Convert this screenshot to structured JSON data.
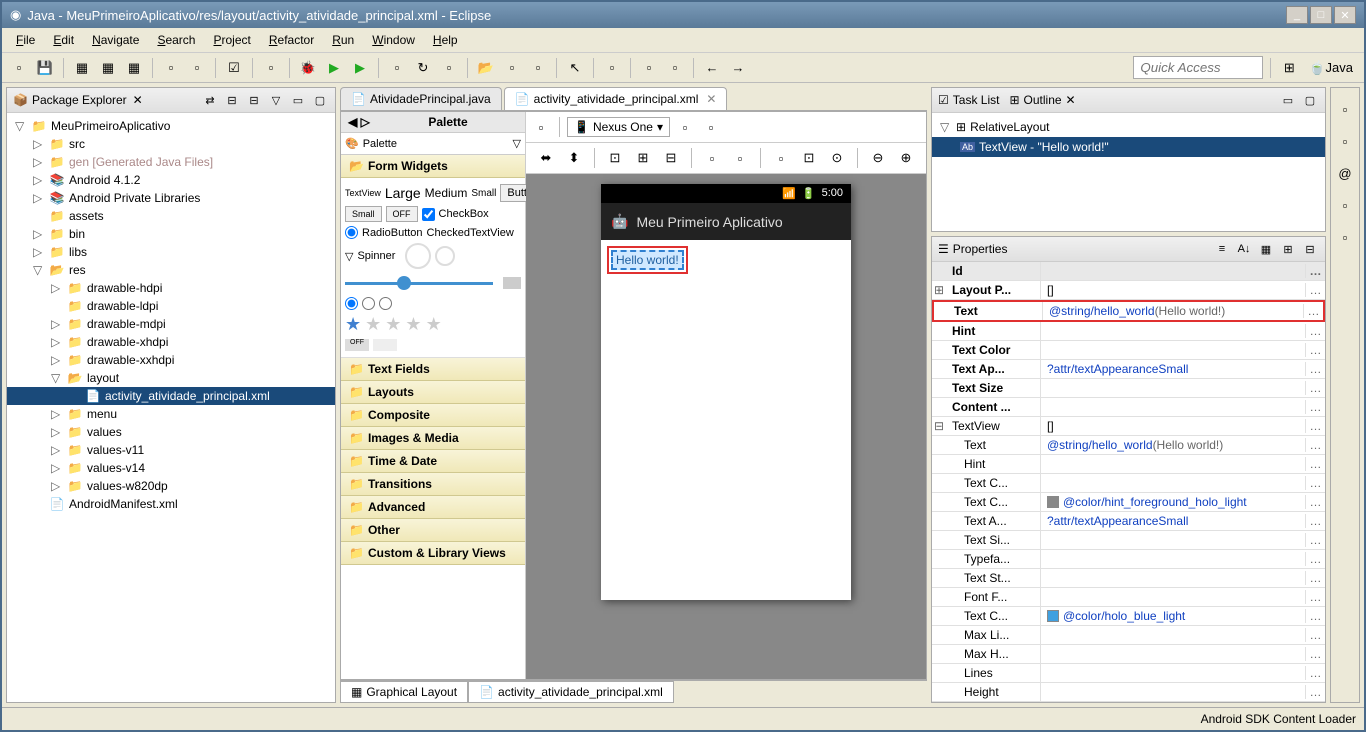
{
  "window": {
    "title": "Java - MeuPrimeiroAplicativo/res/layout/activity_atividade_principal.xml - Eclipse"
  },
  "menu": [
    "File",
    "Edit",
    "Navigate",
    "Search",
    "Project",
    "Refactor",
    "Run",
    "Window",
    "Help"
  ],
  "quick_access_placeholder": "Quick Access",
  "perspective_label": "Java",
  "package_explorer": {
    "title": "Package Explorer",
    "project": "MeuPrimeiroAplicativo",
    "items": [
      {
        "depth": 1,
        "tw": "▷",
        "icon": "📁",
        "label": "src"
      },
      {
        "depth": 1,
        "tw": "▷",
        "icon": "📁",
        "label": "gen [Generated Java Files]",
        "gen": true
      },
      {
        "depth": 1,
        "tw": "▷",
        "icon": "📚",
        "label": "Android 4.1.2"
      },
      {
        "depth": 1,
        "tw": "▷",
        "icon": "📚",
        "label": "Android Private Libraries"
      },
      {
        "depth": 1,
        "tw": "",
        "icon": "📁",
        "label": "assets"
      },
      {
        "depth": 1,
        "tw": "▷",
        "icon": "📁",
        "label": "bin"
      },
      {
        "depth": 1,
        "tw": "▷",
        "icon": "📁",
        "label": "libs"
      },
      {
        "depth": 1,
        "tw": "▽",
        "icon": "📂",
        "label": "res"
      },
      {
        "depth": 2,
        "tw": "▷",
        "icon": "📁",
        "label": "drawable-hdpi"
      },
      {
        "depth": 2,
        "tw": "",
        "icon": "📁",
        "label": "drawable-ldpi"
      },
      {
        "depth": 2,
        "tw": "▷",
        "icon": "📁",
        "label": "drawable-mdpi"
      },
      {
        "depth": 2,
        "tw": "▷",
        "icon": "📁",
        "label": "drawable-xhdpi"
      },
      {
        "depth": 2,
        "tw": "▷",
        "icon": "📁",
        "label": "drawable-xxhdpi"
      },
      {
        "depth": 2,
        "tw": "▽",
        "icon": "📂",
        "label": "layout"
      },
      {
        "depth": 3,
        "tw": "",
        "icon": "📄",
        "label": "activity_atividade_principal.xml",
        "sel": true
      },
      {
        "depth": 2,
        "tw": "▷",
        "icon": "📁",
        "label": "menu"
      },
      {
        "depth": 2,
        "tw": "▷",
        "icon": "📁",
        "label": "values"
      },
      {
        "depth": 2,
        "tw": "▷",
        "icon": "📁",
        "label": "values-v11"
      },
      {
        "depth": 2,
        "tw": "▷",
        "icon": "📁",
        "label": "values-v14"
      },
      {
        "depth": 2,
        "tw": "▷",
        "icon": "📁",
        "label": "values-w820dp"
      },
      {
        "depth": 1,
        "tw": "",
        "icon": "📄",
        "label": "AndroidManifest.xml"
      }
    ]
  },
  "editor": {
    "tabs": [
      {
        "label": "AtividadePrincipal.java",
        "active": false
      },
      {
        "label": "activity_atividade_principal.xml",
        "active": true
      }
    ],
    "palette_title": "Palette",
    "palette_label": "Palette",
    "sections": {
      "form_widgets": "Form Widgets",
      "text_fields": "Text Fields",
      "layouts": "Layouts",
      "composite": "Composite",
      "images_media": "Images & Media",
      "time_date": "Time & Date",
      "transitions": "Transitions",
      "advanced": "Advanced",
      "other": "Other",
      "custom": "Custom & Library Views"
    },
    "widgets": {
      "textview": "TextView",
      "large": "Large",
      "medium": "Medium",
      "small": "Small",
      "button": "Button",
      "small_btn": "Small",
      "off": "OFF",
      "checkbox": "CheckBox",
      "radiobutton": "RadioButton",
      "checkedtext": "CheckedTextView",
      "spinner": "Spinner"
    },
    "device": "Nexus One",
    "phone": {
      "time": "5:00",
      "app_title": "Meu Primeiro Aplicativo",
      "hello": "Hello world!"
    },
    "bottom_tabs": [
      "Graphical Layout",
      "activity_atividade_principal.xml"
    ]
  },
  "outline": {
    "tabs": [
      "Task List",
      "Outline"
    ],
    "root": "RelativeLayout",
    "child": "TextView - \"Hello world!\""
  },
  "properties": {
    "title": "Properties",
    "header_id": "Id",
    "rows": [
      {
        "expand": "⊞",
        "name": "Layout P...",
        "val": "[]",
        "bold": true
      },
      {
        "expand": "",
        "name": "Text",
        "val_link": "@string/hello_world",
        "val_hint": " (Hello world!)",
        "bold": true,
        "hl": true
      },
      {
        "expand": "",
        "name": "Hint",
        "val": "",
        "bold": true
      },
      {
        "expand": "",
        "name": "Text Color",
        "val": "",
        "bold": true
      },
      {
        "expand": "",
        "name": "Text Ap...",
        "val_link": "?attr/textAppearanceSmall",
        "bold": true
      },
      {
        "expand": "",
        "name": "Text Size",
        "val": "",
        "bold": true
      },
      {
        "expand": "",
        "name": "Content ...",
        "val": "",
        "bold": true
      },
      {
        "expand": "⊟",
        "name": "TextView",
        "val": "[]"
      },
      {
        "expand": "",
        "name": "Text",
        "val_link": "@string/hello_world",
        "val_hint": " (Hello world!)",
        "indent": true
      },
      {
        "expand": "",
        "name": "Hint",
        "val": "",
        "indent": true
      },
      {
        "expand": "",
        "name": "Text C...",
        "val": "",
        "indent": true
      },
      {
        "expand": "",
        "name": "Text C...",
        "swatch": "#888",
        "val_link": "@color/hint_foreground_holo_light",
        "indent": true
      },
      {
        "expand": "",
        "name": "Text A...",
        "val_link": "?attr/textAppearanceSmall",
        "indent": true
      },
      {
        "expand": "",
        "name": "Text Si...",
        "val": "",
        "indent": true
      },
      {
        "expand": "",
        "name": "Typefa...",
        "val": "",
        "indent": true
      },
      {
        "expand": "",
        "name": "Text St...",
        "val": "",
        "indent": true
      },
      {
        "expand": "",
        "name": "Font F...",
        "val": "",
        "indent": true
      },
      {
        "expand": "",
        "name": "Text C...",
        "swatch": "#40a0e0",
        "val_link": "@color/holo_blue_light",
        "indent": true
      },
      {
        "expand": "",
        "name": "Max Li...",
        "val": "",
        "indent": true
      },
      {
        "expand": "",
        "name": "Max H...",
        "val": "",
        "indent": true
      },
      {
        "expand": "",
        "name": "Lines",
        "val": "",
        "indent": true
      },
      {
        "expand": "",
        "name": "Height",
        "val": "",
        "indent": true
      }
    ]
  },
  "statusbar": {
    "text": "Android SDK Content Loader"
  }
}
